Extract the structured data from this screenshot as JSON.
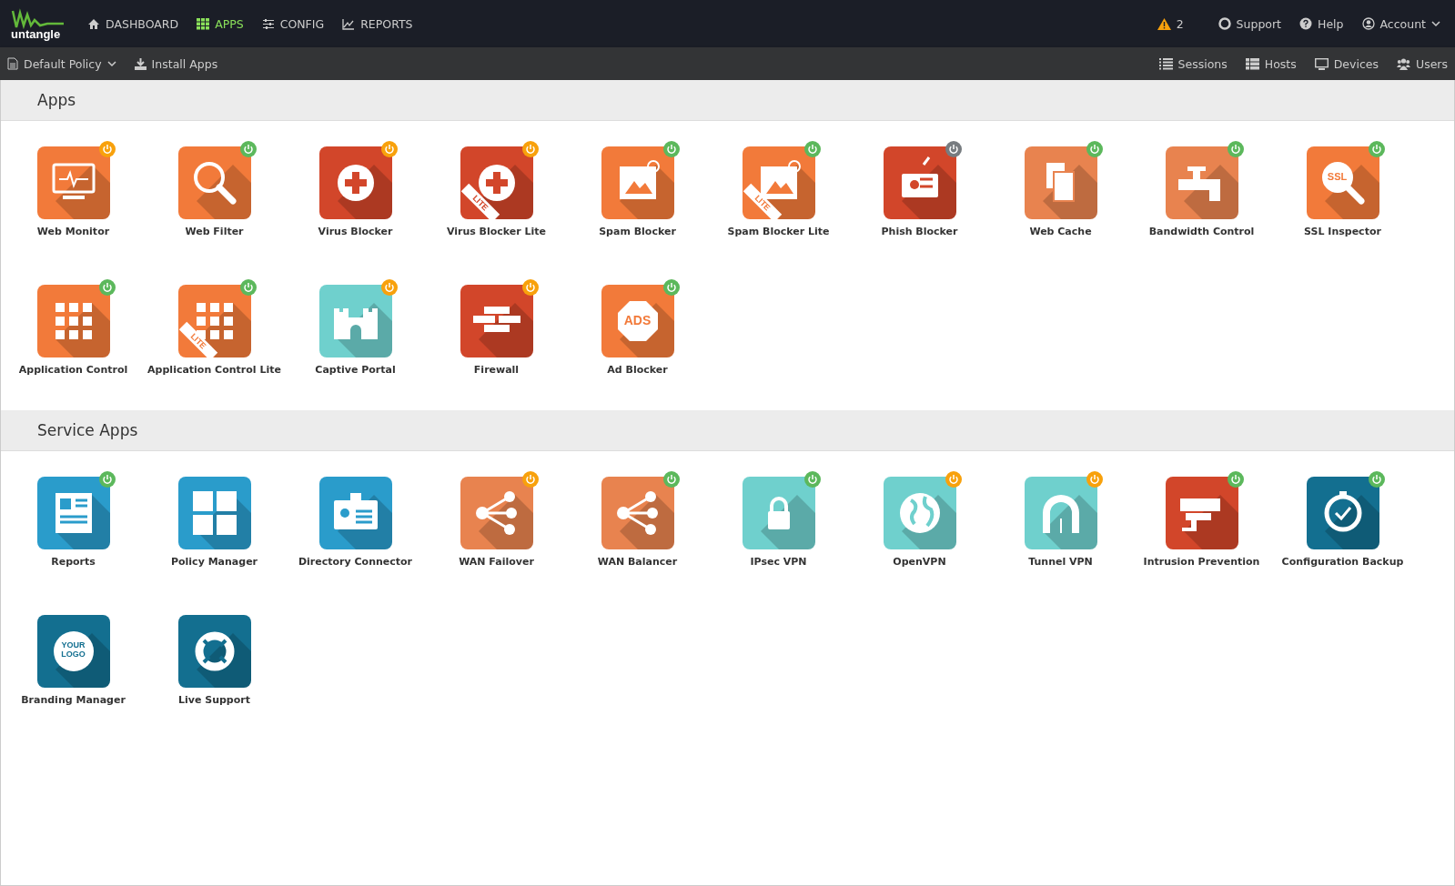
{
  "brand": {
    "name": "untangle"
  },
  "nav": [
    {
      "label": "DASHBOARD",
      "kind": "home",
      "selected": false
    },
    {
      "label": "APPS",
      "kind": "grid",
      "selected": true
    },
    {
      "label": "CONFIG",
      "kind": "sliders",
      "selected": false
    },
    {
      "label": "REPORTS",
      "kind": "chart",
      "selected": false
    }
  ],
  "alerts": {
    "count": "2"
  },
  "top_links": [
    {
      "label": "Support",
      "kind": "lifebuoy"
    },
    {
      "label": "Help",
      "kind": "help"
    },
    {
      "label": "Account",
      "kind": "account"
    }
  ],
  "toolbar": {
    "policy": "Default Policy",
    "install": "Install Apps"
  },
  "toolbar_links": [
    {
      "label": "Sessions",
      "kind": "list"
    },
    {
      "label": "Hosts",
      "kind": "hosts"
    },
    {
      "label": "Devices",
      "kind": "monitor"
    },
    {
      "label": "Users",
      "kind": "users"
    }
  ],
  "sections": [
    {
      "title": "Apps",
      "apps": [
        {
          "name": "Web Monitor",
          "kind": "monitor",
          "color": "#f27a3a",
          "power": {
            "color": "#f8a10c"
          }
        },
        {
          "name": "Web Filter",
          "kind": "magnifier",
          "color": "#f27a3a",
          "power": {
            "color": "#5cb85c"
          }
        },
        {
          "name": "Virus Blocker",
          "kind": "cross",
          "color": "#d2462a",
          "power": {
            "color": "#f8a10c"
          }
        },
        {
          "name": "Virus Blocker Lite",
          "kind": "cross",
          "color": "#d2462a",
          "power": {
            "color": "#f8a10c"
          },
          "ribbon": "LITE"
        },
        {
          "name": "Spam Blocker",
          "kind": "stamp",
          "color": "#f27a3a",
          "power": {
            "color": "#5cb85c"
          }
        },
        {
          "name": "Spam Blocker Lite",
          "kind": "stamp",
          "color": "#f27a3a",
          "power": {
            "color": "#5cb85c"
          },
          "ribbon": "LITE"
        },
        {
          "name": "Phish Blocker",
          "kind": "hook",
          "color": "#d2462a",
          "power": {
            "color": "#777c80"
          }
        },
        {
          "name": "Web Cache",
          "kind": "pages",
          "color": "#e8834f",
          "power": {
            "color": "#5cb85c"
          }
        },
        {
          "name": "Bandwidth Control",
          "kind": "pipe",
          "color": "#e8834f",
          "power": {
            "color": "#5cb85c"
          }
        },
        {
          "name": "SSL Inspector",
          "kind": "text",
          "glyph_text": "SSL",
          "color": "#f27a3a",
          "power": {
            "color": "#5cb85c"
          }
        },
        {
          "name": "Application Control",
          "kind": "squares",
          "color": "#f27a3a",
          "power": {
            "color": "#5cb85c"
          }
        },
        {
          "name": "Application Control Lite",
          "kind": "squares",
          "color": "#f27a3a",
          "power": {
            "color": "#5cb85c"
          },
          "ribbon": "LITE"
        },
        {
          "name": "Captive Portal",
          "kind": "castle",
          "color": "#6fd0cd",
          "power": {
            "color": "#f8a10c"
          }
        },
        {
          "name": "Firewall",
          "kind": "bricks",
          "color": "#d2462a",
          "power": {
            "color": "#f8a10c"
          }
        },
        {
          "name": "Ad Blocker",
          "kind": "octagon",
          "glyph_text": "ADS",
          "color": "#f27a3a",
          "power": {
            "color": "#5cb85c"
          }
        }
      ]
    },
    {
      "title": "Service Apps",
      "apps": [
        {
          "name": "Reports",
          "kind": "report",
          "color": "#2a9ccb",
          "power": {
            "color": "#5cb85c"
          }
        },
        {
          "name": "Policy Manager",
          "kind": "people",
          "color": "#2a9ccb"
        },
        {
          "name": "Directory Connector",
          "kind": "card",
          "color": "#2a9ccb"
        },
        {
          "name": "WAN Failover",
          "kind": "share",
          "color": "#e8834f",
          "power": {
            "color": "#f8a10c"
          }
        },
        {
          "name": "WAN Balancer",
          "kind": "share",
          "color": "#e8834f",
          "power": {
            "color": "#5cb85c"
          }
        },
        {
          "name": "IPsec VPN",
          "kind": "lock",
          "color": "#6fd0cd",
          "power": {
            "color": "#5cb85c"
          }
        },
        {
          "name": "OpenVPN",
          "kind": "globe",
          "color": "#6fd0cd",
          "power": {
            "color": "#f8a10c"
          }
        },
        {
          "name": "Tunnel VPN",
          "kind": "tunnel",
          "color": "#6fd0cd",
          "power": {
            "color": "#f8a10c"
          }
        },
        {
          "name": "Intrusion Prevention",
          "kind": "camera",
          "color": "#d2462a",
          "power": {
            "color": "#5cb85c"
          }
        },
        {
          "name": "Configuration Backup",
          "kind": "clock",
          "color": "#136f90",
          "power": {
            "color": "#5cb85c"
          }
        },
        {
          "name": "Branding Manager",
          "kind": "logo",
          "glyph_text": "YOUR LOGO",
          "color": "#136f90"
        },
        {
          "name": "Live Support",
          "kind": "lifebuoy",
          "color": "#136f90"
        }
      ]
    }
  ]
}
